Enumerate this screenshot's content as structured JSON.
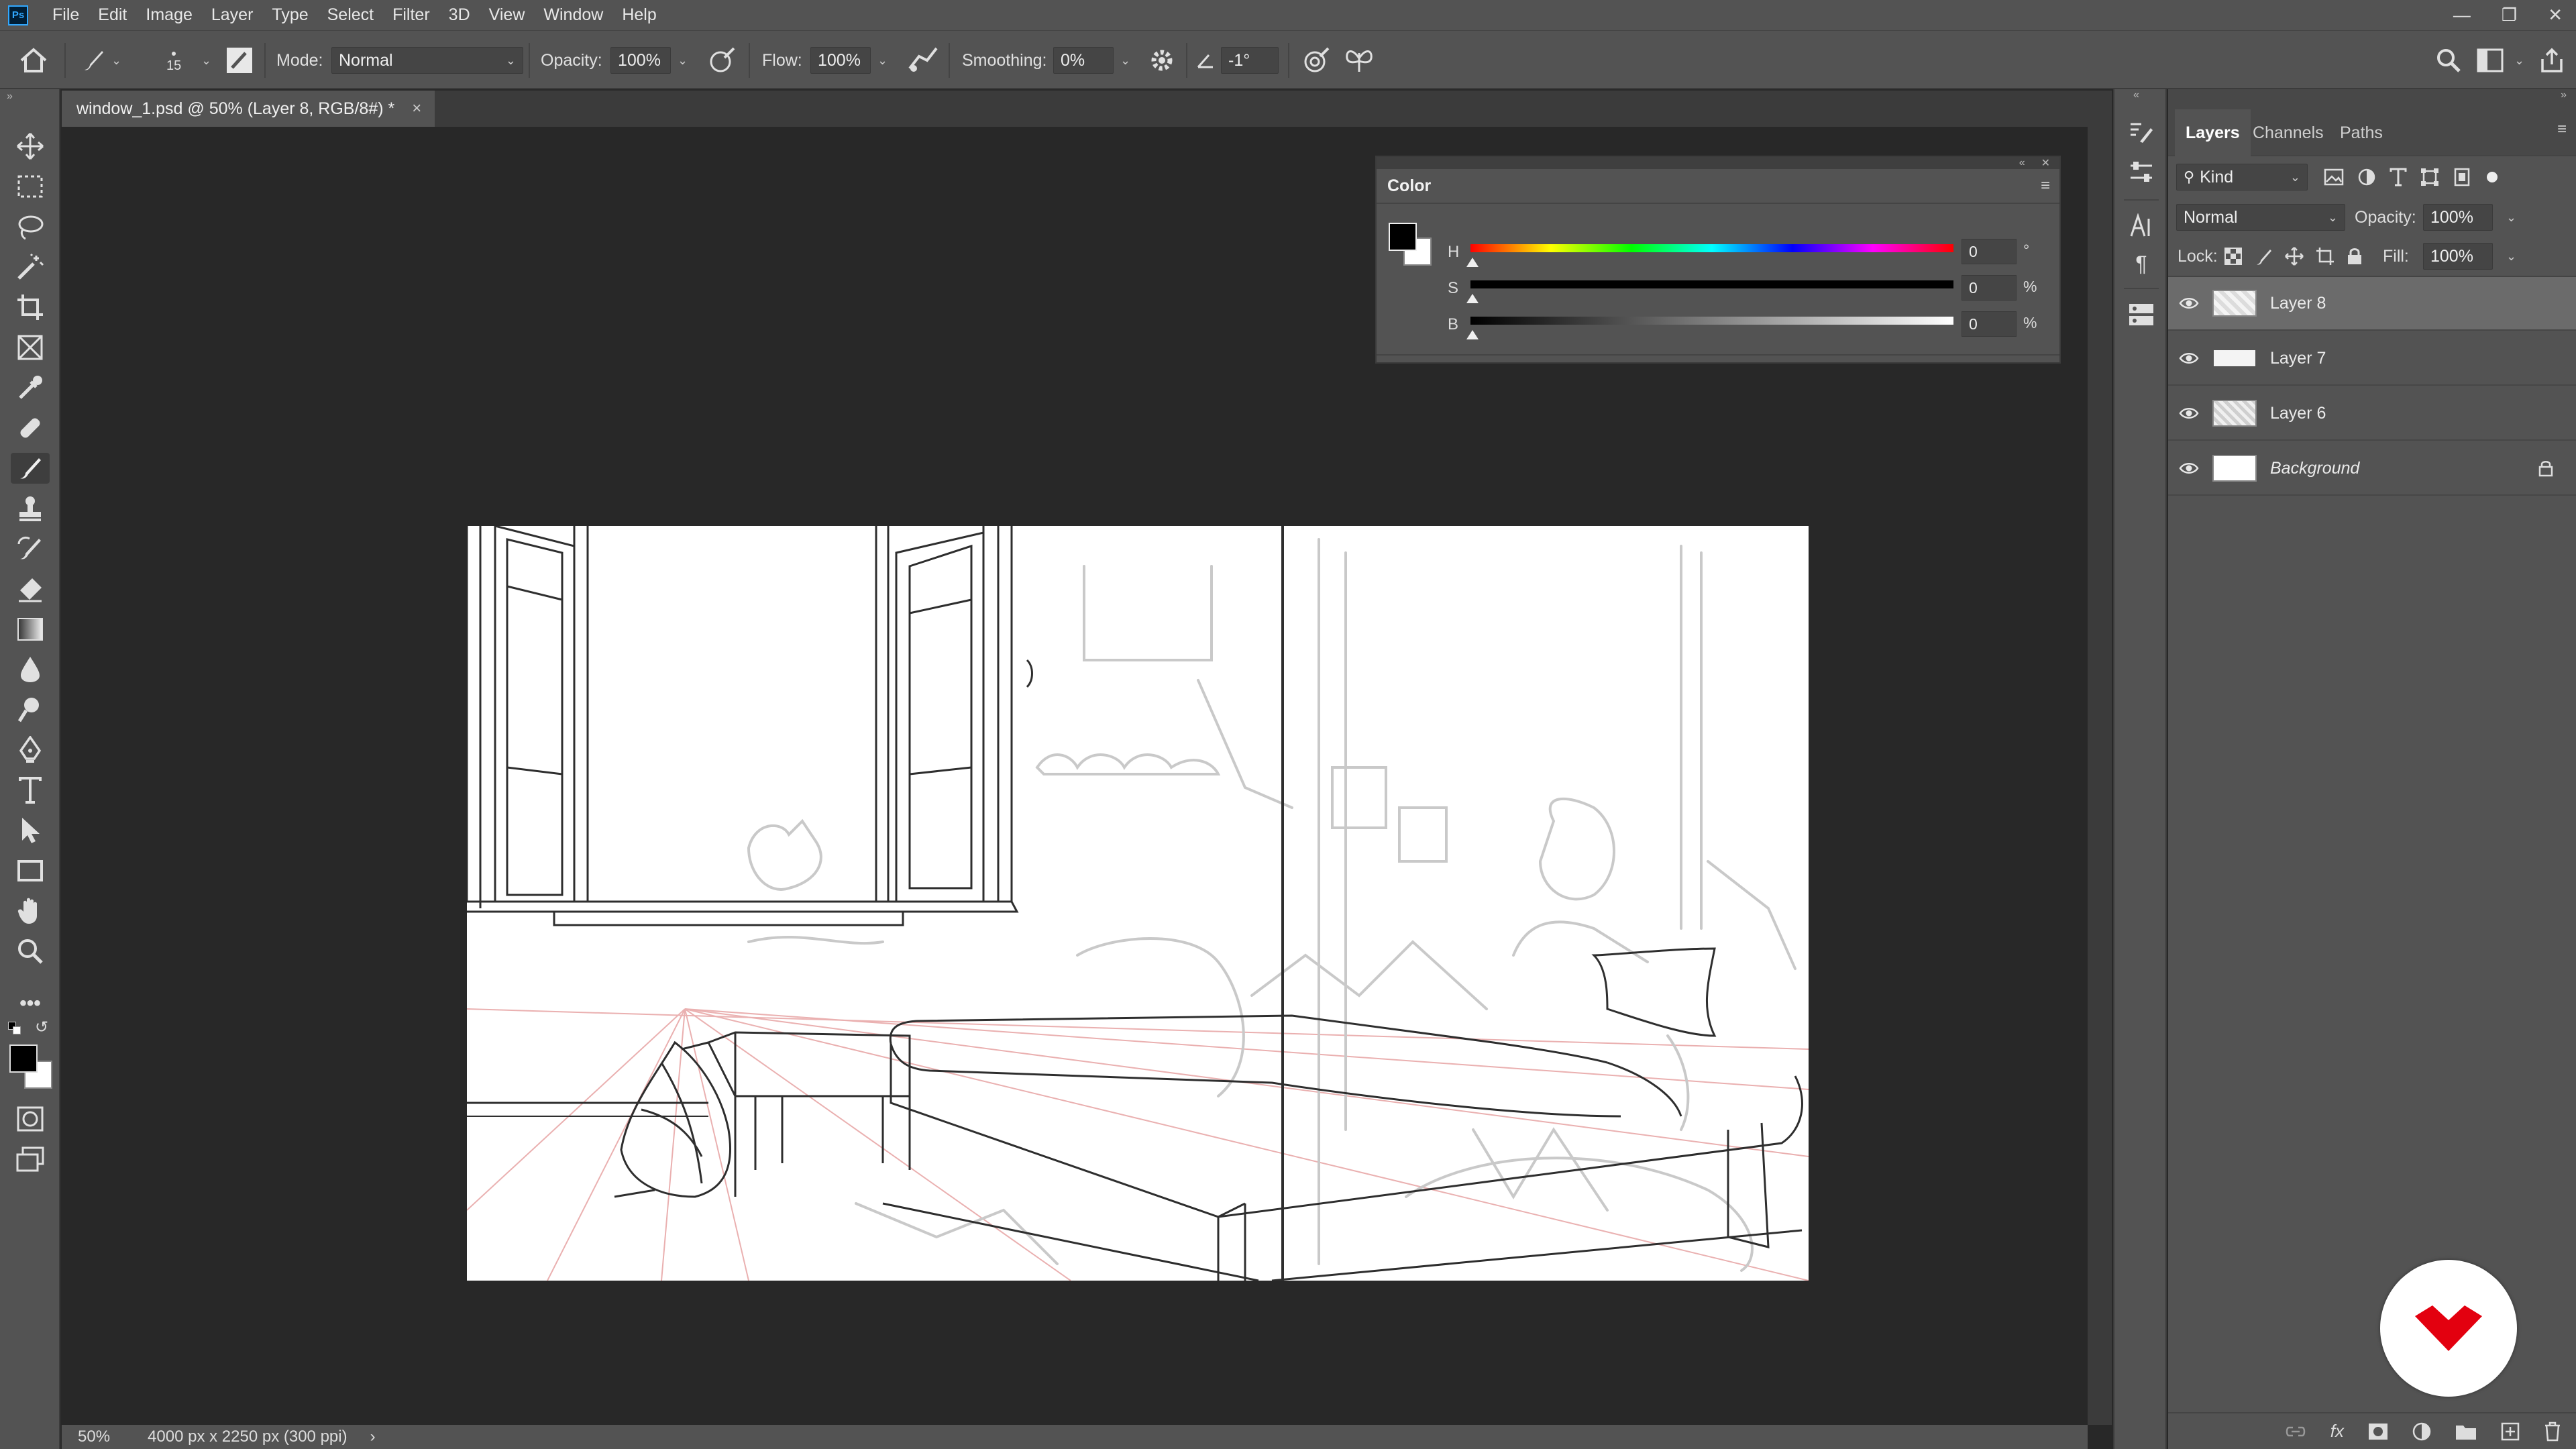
{
  "menubar": {
    "logo": "Ps",
    "items": [
      "File",
      "Edit",
      "Image",
      "Layer",
      "Type",
      "Select",
      "Filter",
      "3D",
      "View",
      "Window",
      "Help"
    ]
  },
  "options": {
    "brush_size": "15",
    "mode_label": "Mode:",
    "mode_value": "Normal",
    "opacity_label": "Opacity:",
    "opacity_value": "100%",
    "flow_label": "Flow:",
    "flow_value": "100%",
    "smoothing_label": "Smoothing:",
    "smoothing_value": "0%",
    "angle_value": "-1°"
  },
  "document": {
    "tab_title": "window_1.psd @ 50% (Layer 8, RGB/8#) *",
    "close_glyph": "×"
  },
  "status": {
    "zoom": "50%",
    "dimensions": "4000 px x 2250 px (300 ppi)",
    "arrow": "›"
  },
  "color_panel": {
    "title": "Color",
    "sliders": [
      {
        "label": "H",
        "value": "0",
        "unit": "°"
      },
      {
        "label": "S",
        "value": "0",
        "unit": "%"
      },
      {
        "label": "B",
        "value": "0",
        "unit": "%"
      }
    ]
  },
  "layers_panel": {
    "tabs": [
      "Layers",
      "Channels",
      "Paths"
    ],
    "filter_value": "Kind",
    "blend_mode": "Normal",
    "opacity_label": "Opacity:",
    "opacity_value": "100%",
    "lock_label": "Lock:",
    "fill_label": "Fill:",
    "fill_value": "100%",
    "layers": [
      {
        "name": "Layer 8",
        "selected": true
      },
      {
        "name": "Layer 7",
        "selected": false
      },
      {
        "name": "Layer 6",
        "selected": false
      },
      {
        "name": "Background",
        "selected": false,
        "locked": true
      }
    ]
  },
  "colors": {
    "accent_red": "#e3000f",
    "panel_bg": "#535353",
    "canvas_bg": "#282828"
  }
}
